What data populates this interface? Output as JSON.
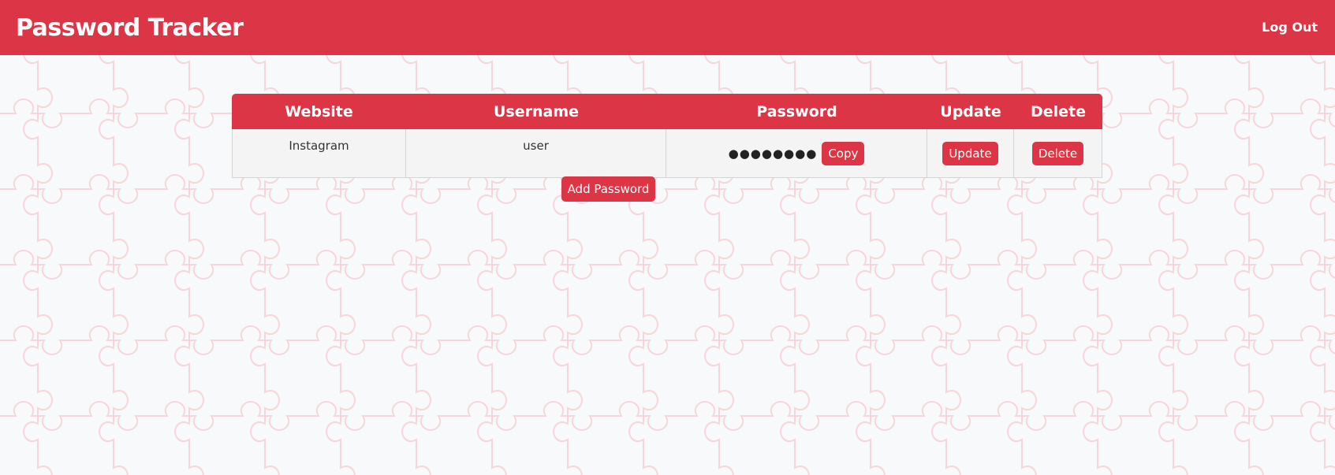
{
  "app": {
    "title": "Password Tracker",
    "logout_label": "Log Out"
  },
  "table": {
    "headers": {
      "website": "Website",
      "username": "Username",
      "password": "Password",
      "update": "Update",
      "delete": "Delete"
    },
    "rows": [
      {
        "website": "Instagram",
        "username": "user",
        "password_masked": "●●●●●●●●",
        "copy_label": "Copy",
        "update_label": "Update",
        "delete_label": "Delete"
      }
    ]
  },
  "actions": {
    "add_password_label": "Add Password"
  },
  "colors": {
    "accent": "#dc3545",
    "background": "#f8f9fa",
    "pattern": "#f6d6da",
    "row_background": "#f4f4f4"
  },
  "icons": {
    "background": "puzzle-pattern"
  }
}
